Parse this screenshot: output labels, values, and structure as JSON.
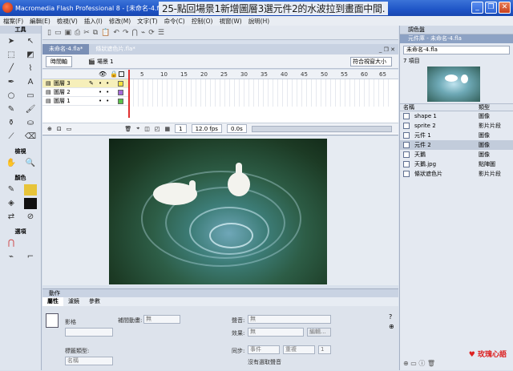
{
  "window": {
    "title": "Macromedia Flash Professional 8 - [未命名-4.fla*]",
    "caption": "25-點回場景1新增圖層3選元件2的水波拉到畫面中間."
  },
  "menu": [
    "檔案(F)",
    "編輯(E)",
    "檢視(V)",
    "插入(I)",
    "修改(M)",
    "文字(T)",
    "命令(C)",
    "控制(O)",
    "視窗(W)",
    "說明(H)"
  ],
  "tools": {
    "header": "工具",
    "view_label": "檢視",
    "color_label": "顏色",
    "options_label": "選項"
  },
  "doc": {
    "tabs": [
      "未命名-4.fla*",
      "條狀遮色片.fla*"
    ],
    "timeline_btn": "時間軸",
    "scene": "場景 1",
    "zoom": "符合視窗大小"
  },
  "timeline": {
    "frame_numbers": [
      "5",
      "10",
      "15",
      "20",
      "25",
      "30",
      "35",
      "40",
      "45",
      "50",
      "55",
      "60",
      "65"
    ],
    "layers": [
      {
        "name": "圖層 3",
        "color": "#f5e23b"
      },
      {
        "name": "圖層 2",
        "color": "#a46bd8"
      },
      {
        "name": "圖層 1",
        "color": "#5bc24a"
      }
    ],
    "current_frame": "1",
    "fps": "12.0 fps",
    "time": "0.0s"
  },
  "properties": {
    "title": "動作",
    "tabs": [
      "屬性",
      "濾鏡",
      "參數"
    ],
    "shape_label": "影格",
    "tween_label": "補間動畫:",
    "tween_value": "無",
    "label_type": "標籤類型:",
    "label_type_value": "名稱",
    "sound_label": "聲音:",
    "sound_value": "無",
    "effect_label": "效果:",
    "effect_value": "無",
    "edit_btn": "編輯...",
    "sync_label": "同步:",
    "sync_value": "事件",
    "repeat_value": "重複",
    "repeat_count": "1",
    "no_sound": "沒有選取聲音"
  },
  "library": {
    "color_panel": "調色盤",
    "title": "元件庫 - 未命名-4.fla",
    "file": "未命名-4.fla",
    "count": "7 項目",
    "col_name": "名稱",
    "col_type": "類型",
    "items": [
      {
        "name": "shape 1",
        "type": "圖像"
      },
      {
        "name": "sprite 2",
        "type": "影片片段"
      },
      {
        "name": "元件 1",
        "type": "圖像"
      },
      {
        "name": "元件 2",
        "type": "圖像"
      },
      {
        "name": "天鵝",
        "type": "圖像"
      },
      {
        "name": "天鵝.jpg",
        "type": "點陣圖"
      },
      {
        "name": "條狀遮色片",
        "type": "影片片段"
      }
    ],
    "selected_index": 3,
    "watermark": "♥ 玫瑰心語"
  },
  "colors": {
    "titlebar": "#1f55c7",
    "selected_layer": "#f6efba",
    "playhead": "#e03030"
  }
}
